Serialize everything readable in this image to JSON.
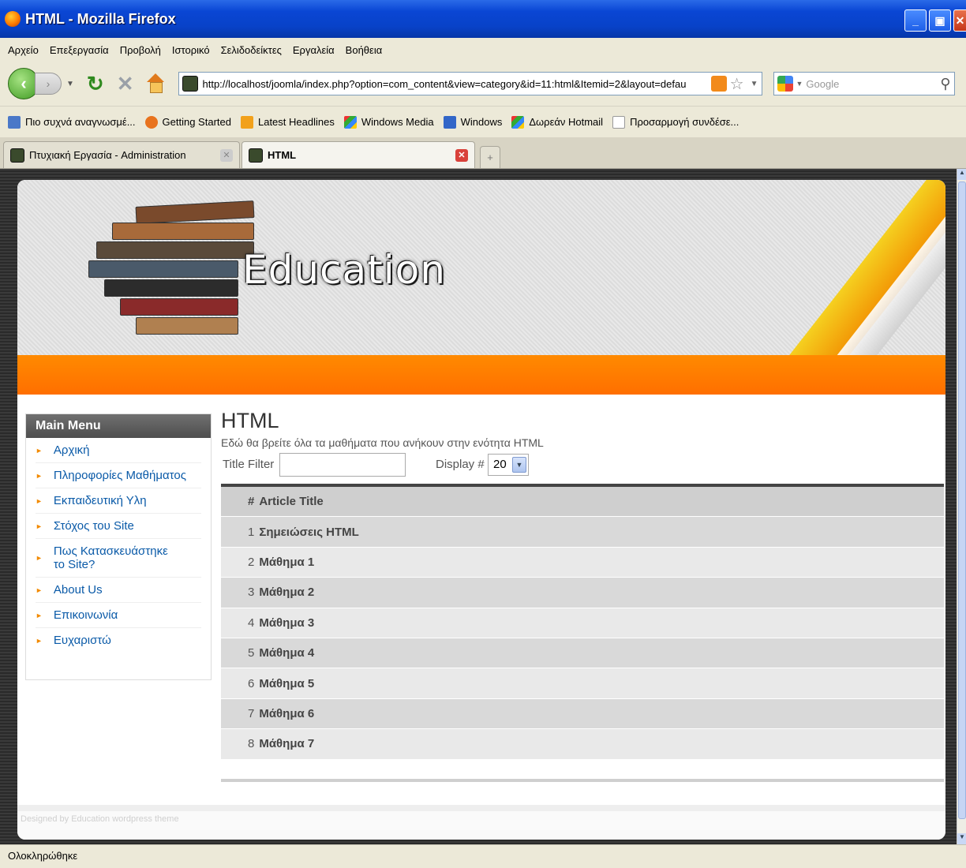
{
  "window": {
    "title": "HTML - Mozilla Firefox"
  },
  "menubar": [
    "Αρχείο",
    "Επεξεργασία",
    "Προβολή",
    "Ιστορικό",
    "Σελιδοδείκτες",
    "Εργαλεία",
    "Βοήθεια"
  ],
  "nav": {
    "url": "http://localhost/joomla/index.php?option=com_content&view=category&id=11:html&Itemid=2&layout=defau",
    "search_placeholder": "Google"
  },
  "bookmarks": [
    {
      "label": "Πιο συχνά αναγνωσμέ...",
      "icon": "most-visited-icon",
      "color": "#4a78c8"
    },
    {
      "label": "Getting Started",
      "icon": "firefox-icon",
      "color": "#e8731e"
    },
    {
      "label": "Latest Headlines",
      "icon": "rss-icon",
      "color": "#f2a11b"
    },
    {
      "label": "Windows Media",
      "icon": "windows-icon",
      "color": "#3a88d8"
    },
    {
      "label": "Windows",
      "icon": "windows-live-icon",
      "color": "#3266c8"
    },
    {
      "label": "Δωρεάν Hotmail",
      "icon": "windows-icon",
      "color": "#3a88d8"
    },
    {
      "label": "Προσαρμογή συνδέσε...",
      "icon": "page-icon",
      "color": "#ffffff"
    }
  ],
  "tabs": [
    {
      "label": "Πτυχιακή Εργασία - Administration",
      "active": false
    },
    {
      "label": "HTML",
      "active": true
    }
  ],
  "site": {
    "header_title": "Education",
    "menu_title": "Main Menu",
    "menu_items": [
      "Αρχική",
      "Πληροφορίες Μαθήματος",
      "Εκπαιδευτική Υλη",
      "Στόχος του Site",
      "Πως Κατασκευάστηκε το Site?",
      "About Us",
      "Επικοινωνία",
      "Ευχαριστώ"
    ],
    "category_title": "HTML",
    "category_desc": "Εδώ θα βρείτε όλα τα μαθήματα που ανήκουν στην ενότητα HTML",
    "filter_label": "Title Filter",
    "filter_value": "",
    "display_label": "Display #",
    "display_value": "20",
    "table_header": {
      "num": "#",
      "title": "Article Title"
    },
    "articles": [
      {
        "num": "1",
        "title": "Σημειώσεις HTML"
      },
      {
        "num": "2",
        "title": "Μάθημα 1"
      },
      {
        "num": "3",
        "title": "Μάθημα 2"
      },
      {
        "num": "4",
        "title": "Μάθημα 3"
      },
      {
        "num": "5",
        "title": "Μάθημα 4"
      },
      {
        "num": "6",
        "title": "Μάθημα 5"
      },
      {
        "num": "7",
        "title": "Μάθημα 6"
      },
      {
        "num": "8",
        "title": "Μάθημα 7"
      }
    ],
    "footer": "Designed by Education wordpress theme"
  },
  "status": "Ολοκληρώθηκε"
}
